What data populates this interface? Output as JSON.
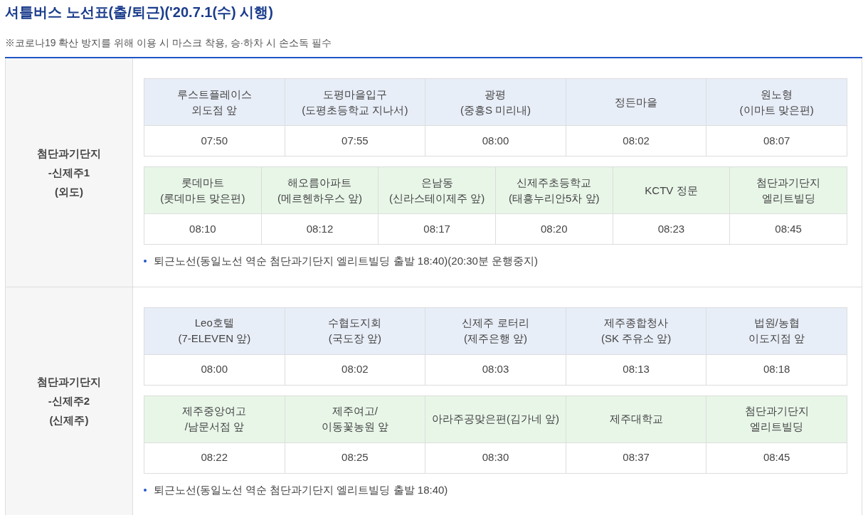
{
  "title": "셔틀버스 노선표(출/퇴근)('20.7.1(수) 시행)",
  "notice": "※코로나19 확산 방지를 위해 이용 시 마스크 착용, 승·하차 시 손소독 필수",
  "routes": [
    {
      "name": "첨단과기단지\n-신제주1\n(외도)",
      "tables": [
        {
          "kind": "blue",
          "stops": [
            {
              "name": "루스트플레이스\n외도점 앞",
              "time": "07:50"
            },
            {
              "name": "도평마을입구\n(도평초등학교 지나서)",
              "time": "07:55"
            },
            {
              "name": "광평\n(중흥S 미리내)",
              "time": "08:00"
            },
            {
              "name": "정든마을",
              "time": "08:02"
            },
            {
              "name": "원노형\n(이마트 맞은편)",
              "time": "08:07"
            }
          ]
        },
        {
          "kind": "green",
          "stops": [
            {
              "name": "롯데마트\n(롯데마트 맞은편)",
              "time": "08:10"
            },
            {
              "name": "해오름아파트\n(메르헨하우스 앞)",
              "time": "08:12"
            },
            {
              "name": "은남동\n(신라스테이제주 앞)",
              "time": "08:17"
            },
            {
              "name": "신제주초등학교\n(태흥누리안5차 앞)",
              "time": "08:20"
            },
            {
              "name": "KCTV 정문",
              "time": "08:23"
            },
            {
              "name": "첨단과기단지\n엘리트빌딩",
              "time": "08:45"
            }
          ]
        }
      ],
      "note": "퇴근노선(동일노선 역순 첨단과기단지 엘리트빌딩 출발 18:40)(20:30분 운행중지)"
    },
    {
      "name": "첨단과기단지\n-신제주2\n(신제주)",
      "tables": [
        {
          "kind": "blue",
          "stops": [
            {
              "name": "Leo호텔\n(7-ELEVEN 앞)",
              "time": "08:00"
            },
            {
              "name": "수협도지회\n(국도장 앞)",
              "time": "08:02"
            },
            {
              "name": "신제주 로터리\n(제주은행 앞)",
              "time": "08:03"
            },
            {
              "name": "제주종합청사\n(SK 주유소 앞)",
              "time": "08:13"
            },
            {
              "name": "법원/농협\n이도지점 앞",
              "time": "08:18"
            }
          ]
        },
        {
          "kind": "green",
          "stops": [
            {
              "name": "제주중앙여고\n/남문서점 앞",
              "time": "08:22"
            },
            {
              "name": "제주여고/\n이동꽃농원 앞",
              "time": "08:25"
            },
            {
              "name": "아라주공맞은편(김가네 앞)",
              "time": "08:30"
            },
            {
              "name": "제주대학교",
              "time": "08:37"
            },
            {
              "name": "첨단과기단지\n엘리트빌딩",
              "time": "08:45"
            }
          ]
        }
      ],
      "note": "퇴근노선(동일노선 역순 첨단과기단지 엘리트빌딩 출발 18:40)"
    }
  ]
}
